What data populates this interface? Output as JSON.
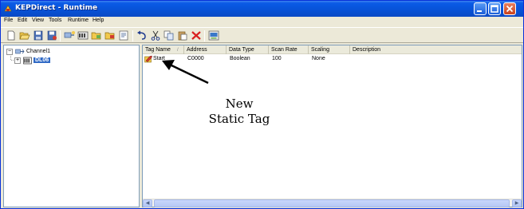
{
  "window": {
    "title": "KEPDirect - Runtime",
    "accent": "#0a5ae6"
  },
  "menu": [
    "File",
    "Edit",
    "View",
    "Tools",
    "Runtime",
    "Help"
  ],
  "toolbar": {
    "buttons": [
      "new-icon",
      "open-icon",
      "save-icon",
      "save-as-icon",
      "new-channel-icon",
      "new-device-icon",
      "new-group-icon",
      "new-tag-icon",
      "properties-icon",
      "undo-icon",
      "cut-icon",
      "copy-icon",
      "paste-icon",
      "delete-icon",
      "quick-client-icon"
    ]
  },
  "tree": {
    "channel": "Channel1",
    "device": "DL06"
  },
  "list": {
    "columns": [
      "Tag Name",
      "Address",
      "Data Type",
      "Scan Rate",
      "Scaling",
      "Description"
    ],
    "rows": [
      {
        "tag_name": "Start",
        "address": "C0000",
        "data_type": "Boolean",
        "scan_rate": "100",
        "scaling": "None",
        "description": ""
      }
    ]
  },
  "annotation": {
    "line1": "New",
    "line2": "Static Tag"
  }
}
